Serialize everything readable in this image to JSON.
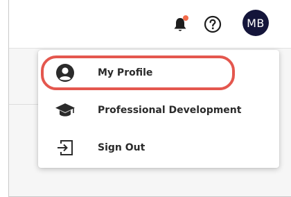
{
  "header": {
    "avatar_initials": "MB",
    "notification_icon": "bell-icon",
    "help_icon": "help-circle-icon",
    "notification_dot_color": "#f26b4a",
    "avatar_color": "#14153a"
  },
  "user_menu": {
    "items": [
      {
        "label": "My Profile",
        "icon": "user-circle-icon",
        "highlighted": true
      },
      {
        "label": "Professional Development",
        "icon": "graduation-cap-icon"
      },
      {
        "label": "Sign Out",
        "icon": "sign-out-icon"
      }
    ],
    "highlight_color": "#e4574e"
  }
}
